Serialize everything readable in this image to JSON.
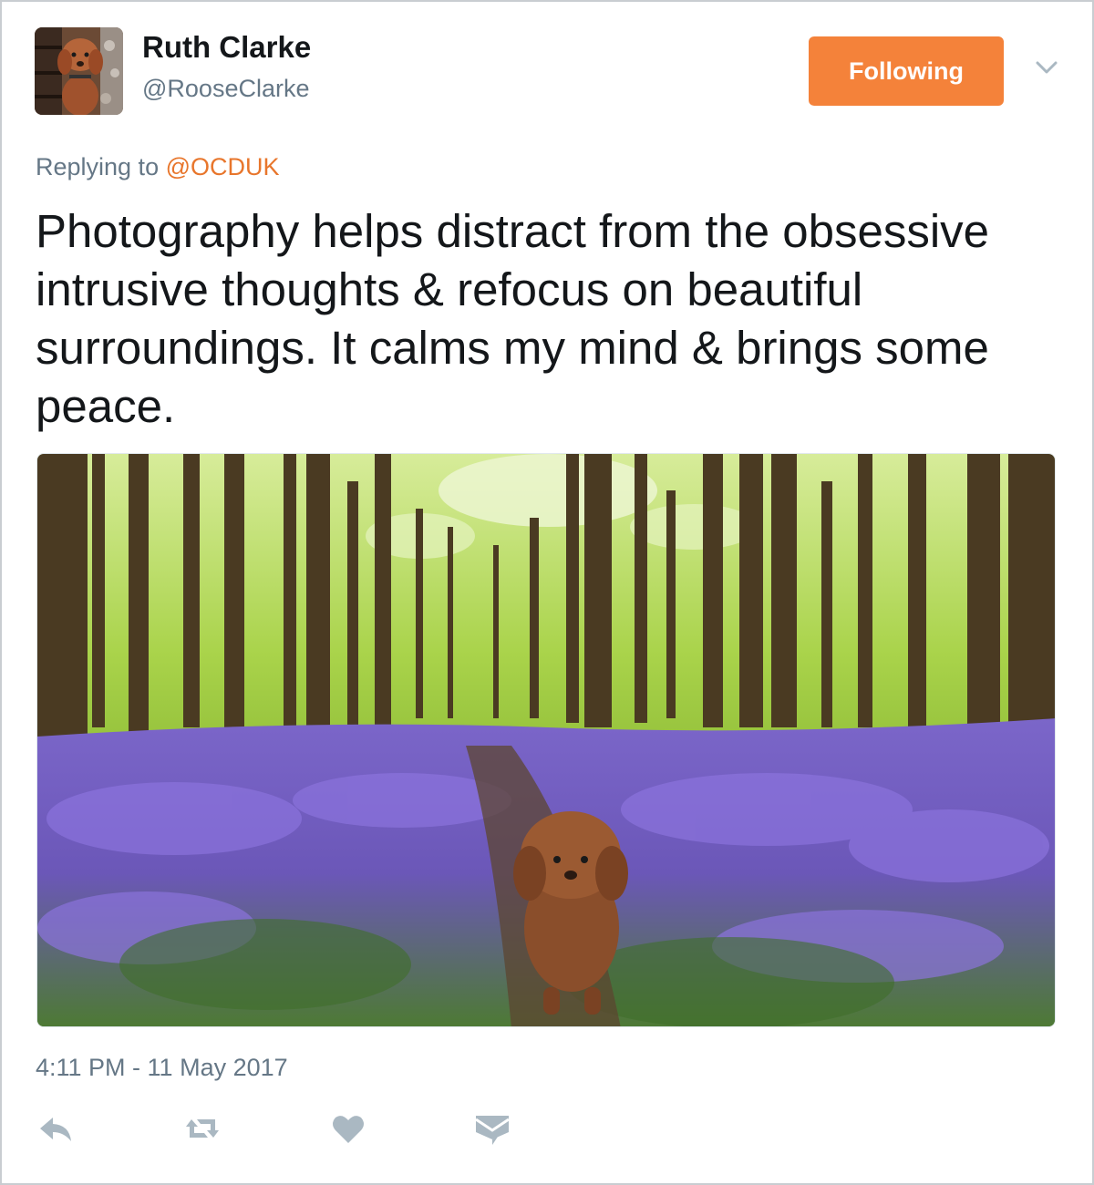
{
  "author": {
    "name": "Ruth Clarke",
    "handle": "@RooseClarke",
    "avatar_icon": "dog-avatar"
  },
  "follow_button": {
    "label": "Following",
    "color": "#f4823a"
  },
  "menu_icon": "chevron-down-icon",
  "reply": {
    "prefix": "Replying to",
    "mention": "@OCDUK",
    "mention_color": "#e8762c"
  },
  "tweet": {
    "text": "Photography helps distract from the obsessive intrusive thoughts & refocus on beautiful surroundings. It calms my mind & brings some peace."
  },
  "media": {
    "icon": "photo-bluebell-woods-with-dog"
  },
  "timestamp": "4:11 PM - 11 May 2017",
  "actions": [
    "reply-icon",
    "retweet-icon",
    "like-icon",
    "direct-message-icon"
  ],
  "colors": {
    "text": "#14171a",
    "secondary": "#657786",
    "icon": "#aab8c2"
  }
}
